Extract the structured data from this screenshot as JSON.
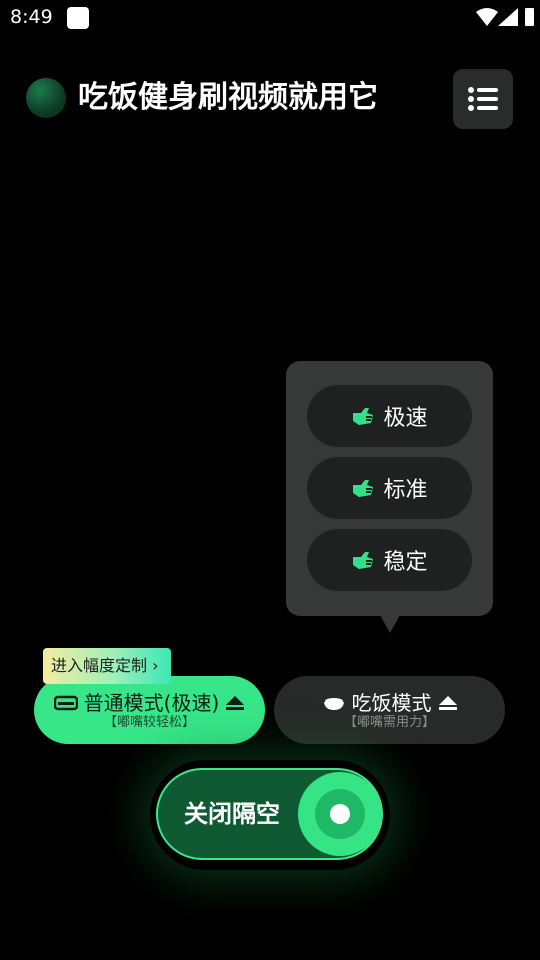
{
  "status_bar": {
    "time": "8:49"
  },
  "header": {
    "title": "吃饭健身刷视频就用它",
    "menu_icon": "list-menu-icon"
  },
  "speed_popup": {
    "options": [
      {
        "label": "极速",
        "icon": "gesture-hand-icon"
      },
      {
        "label": "标准",
        "icon": "gesture-hand-icon"
      },
      {
        "label": "稳定",
        "icon": "gesture-hand-icon"
      }
    ]
  },
  "custom_tag": {
    "label": "进入幅度定制 ›"
  },
  "modes": {
    "normal": {
      "label": "普通模式(极速)",
      "sub": "【嘟嘴较轻松】",
      "icon": "sofa-icon",
      "selected": true
    },
    "eat": {
      "label": "吃饭模式",
      "sub": "【嘟嘴需用力】",
      "icon": "rice-bowl-icon",
      "selected": false
    }
  },
  "isolation_toggle": {
    "label": "关闭隔空",
    "on": true
  },
  "colors": {
    "accent": "#37e689",
    "popup_bg": "#363938",
    "option_bg": "#1f2120",
    "dark_button": "#282a29"
  }
}
